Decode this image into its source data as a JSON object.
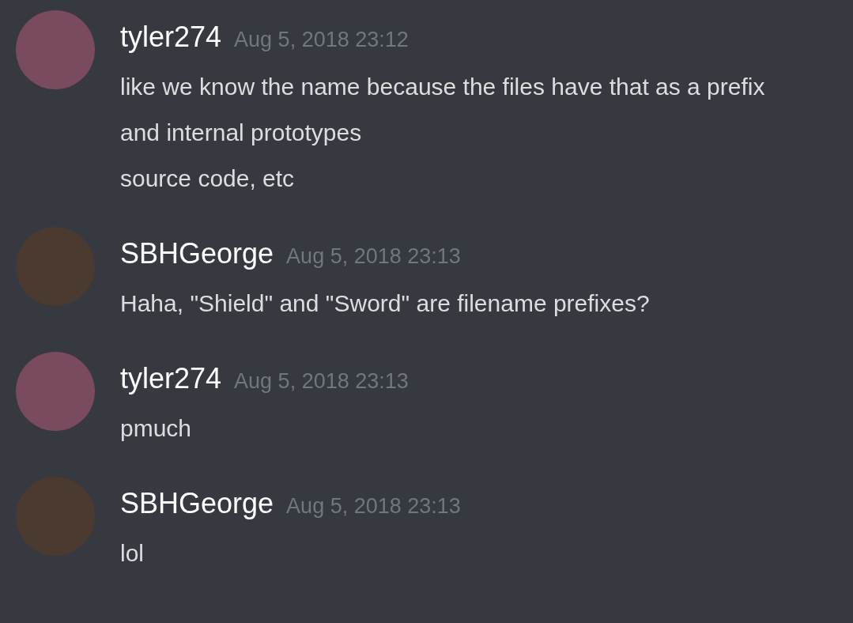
{
  "messages": [
    {
      "author": "tyler274",
      "timestamp": "Aug 5, 2018 23:12",
      "color": "#7a4a5e",
      "lines": [
        "like we know the name because the files have that as a prefix",
        "and internal prototypes",
        "source code, etc"
      ]
    },
    {
      "author": "SBHGeorge",
      "timestamp": "Aug 5, 2018 23:13",
      "color": "#4a3a30",
      "lines": [
        "Haha, \"Shield\" and \"Sword\" are filename prefixes?"
      ]
    },
    {
      "author": "tyler274",
      "timestamp": "Aug 5, 2018 23:13",
      "color": "#7a4a5e",
      "lines": [
        "pmuch"
      ]
    },
    {
      "author": "SBHGeorge",
      "timestamp": "Aug 5, 2018 23:13",
      "color": "#4a3a30",
      "lines": [
        "lol"
      ]
    }
  ]
}
